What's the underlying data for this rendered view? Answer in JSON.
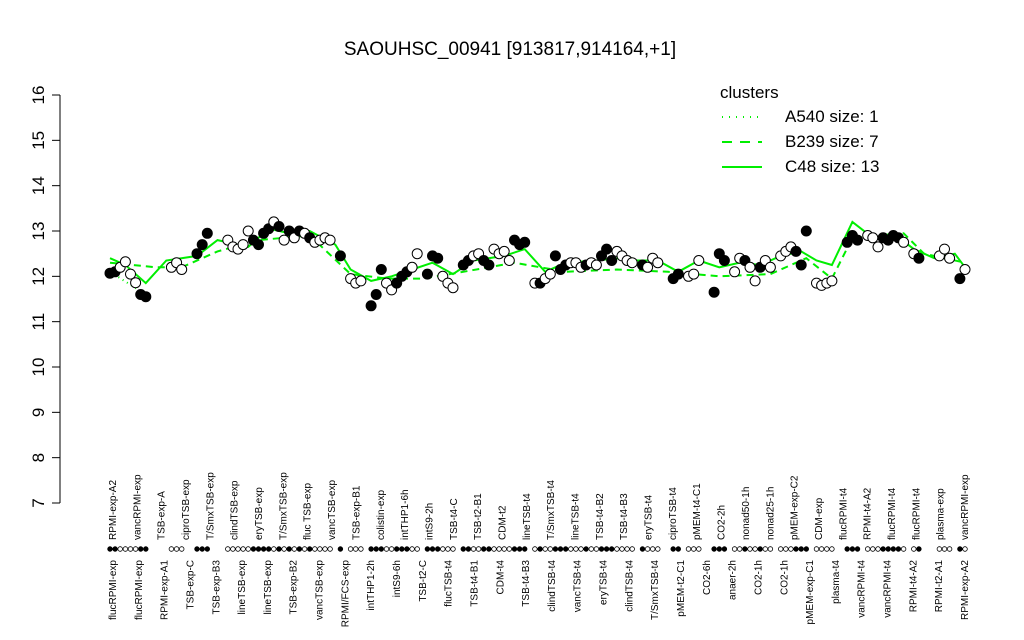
{
  "chart_data": {
    "type": "scatter",
    "title": "SAOUHSC_00941 [913817,914164,+1]",
    "xlabel": "",
    "ylabel": "",
    "ylim": [
      7,
      16
    ],
    "y_ticks": [
      "7",
      "8",
      "9",
      "10",
      "11",
      "12",
      "13",
      "14",
      "15",
      "16"
    ],
    "legend": {
      "title": "clusters",
      "position": "top-right",
      "entries": [
        {
          "label": "A540 size: 1",
          "style": "dotted"
        },
        {
          "label": "B239 size: 7",
          "style": "dashed"
        },
        {
          "label": "C48 size: 13",
          "style": "solid"
        }
      ]
    },
    "colors": {
      "cluster_line": "#00ee00",
      "points": "#000000",
      "text": "#000000"
    },
    "x_labels_top": [
      "RPMI-exp-A2",
      "vancRPMI-exp",
      "TSB-exp-A",
      "ciproTSB-exp",
      "T/SmxTSB-exp",
      "clindTSB-exp",
      "eryTSB-exp",
      "T/SmxTSB-exp",
      "fluc TSB-exp",
      "vancTSB-exp",
      "TSB-exp-B1",
      "colistin-exp",
      "intTHP1-6h",
      "intS9-2h",
      "TSB-t4-C",
      "TSB-t2-B1",
      "CDM-t2",
      "lineTSB-t4",
      "T/SmxTSB-t4",
      "lineTSB-t4",
      "TSB-t4-B2",
      "TSB-t4-B3",
      "eryTSB-t4",
      "ciproTSB-t4",
      "pMEM-t4-C1",
      "CO2-2h",
      "nonad50-1h",
      "nonad25-1h",
      "pMEM-exp-C2",
      "CDM-exp",
      "flucRPMI-t4",
      "RPMI-t4-A2",
      "flucRPMI-t4",
      "flucRPMI-t4",
      "plasma-exp",
      "vancRPMI-exp"
    ],
    "x_labels_bottom": [
      "flucRPMI-exp",
      "flucRPMI-exp",
      "RPMI-exp-A1",
      "TSB-exp-C",
      "TSB-exp-B3",
      "lineTSB-exp",
      "lineTSB-exp",
      "TSB-exp-B2",
      "vancTSB-exp",
      "RPMI/FCS-exp",
      "intTHP1-2h",
      "intS9-6h",
      "TSB-t2-C",
      "flucTSB-t4",
      "TSB-t4-B1",
      "CDM-t4",
      "TSB-t4-B3",
      "clindTSB-t4",
      "vancTSB-t4",
      "eryTSB-t4",
      "clindTSB-t4",
      "T/SmxTSB-t4",
      "pMEM-t2-C1",
      "CO2-6h",
      "anaer-2h",
      "CO2-1h",
      "CO2-1h",
      "pMEM-exp-C1",
      "plasma-t4",
      "vancRPMI-t4",
      "vancRPMI-t4",
      "RPMI-t4-A2",
      "RPMI-t2-A1",
      "RPMI-exp-A2"
    ],
    "points": [
      [
        1,
        12.07,
        1
      ],
      [
        2,
        12.1,
        1
      ],
      [
        3,
        12.2,
        0
      ],
      [
        4,
        12.32,
        0
      ],
      [
        5,
        12.05,
        0
      ],
      [
        6,
        11.86,
        0
      ],
      [
        7,
        11.6,
        1
      ],
      [
        8,
        11.55,
        1
      ],
      [
        13,
        12.2,
        0
      ],
      [
        14,
        12.3,
        0
      ],
      [
        15,
        12.15,
        0
      ],
      [
        18,
        12.5,
        1
      ],
      [
        19,
        12.7,
        1
      ],
      [
        20,
        12.95,
        1
      ],
      [
        24,
        12.8,
        0
      ],
      [
        25,
        12.65,
        0
      ],
      [
        26,
        12.6,
        0
      ],
      [
        27,
        12.7,
        0
      ],
      [
        28,
        13.0,
        0
      ],
      [
        29,
        12.8,
        1
      ],
      [
        30,
        12.7,
        1
      ],
      [
        31,
        12.95,
        1
      ],
      [
        32,
        13.05,
        1
      ],
      [
        33,
        13.2,
        0
      ],
      [
        34,
        13.1,
        1
      ],
      [
        35,
        12.8,
        0
      ],
      [
        36,
        13.0,
        1
      ],
      [
        37,
        12.85,
        0
      ],
      [
        38,
        13.0,
        1
      ],
      [
        39,
        12.95,
        0
      ],
      [
        40,
        12.85,
        1
      ],
      [
        41,
        12.75,
        0
      ],
      [
        42,
        12.8,
        0
      ],
      [
        43,
        12.85,
        0
      ],
      [
        44,
        12.8,
        0
      ],
      [
        46,
        12.45,
        1
      ],
      [
        48,
        11.95,
        0
      ],
      [
        49,
        11.85,
        0
      ],
      [
        50,
        11.9,
        0
      ],
      [
        52,
        11.35,
        1
      ],
      [
        53,
        11.6,
        1
      ],
      [
        54,
        12.15,
        1
      ],
      [
        55,
        11.85,
        0
      ],
      [
        56,
        11.7,
        0
      ],
      [
        57,
        11.85,
        1
      ],
      [
        58,
        12.0,
        1
      ],
      [
        59,
        12.1,
        1
      ],
      [
        60,
        12.2,
        0
      ],
      [
        61,
        12.5,
        0
      ],
      [
        63,
        12.05,
        1
      ],
      [
        64,
        12.45,
        1
      ],
      [
        65,
        12.4,
        1
      ],
      [
        66,
        12.0,
        0
      ],
      [
        67,
        11.85,
        0
      ],
      [
        68,
        11.75,
        0
      ],
      [
        70,
        12.25,
        1
      ],
      [
        71,
        12.35,
        1
      ],
      [
        72,
        12.45,
        0
      ],
      [
        73,
        12.5,
        0
      ],
      [
        74,
        12.35,
        1
      ],
      [
        75,
        12.25,
        1
      ],
      [
        76,
        12.6,
        0
      ],
      [
        77,
        12.5,
        0
      ],
      [
        78,
        12.55,
        0
      ],
      [
        79,
        12.35,
        0
      ],
      [
        80,
        12.8,
        1
      ],
      [
        81,
        12.7,
        1
      ],
      [
        82,
        12.75,
        1
      ],
      [
        84,
        11.85,
        0
      ],
      [
        85,
        11.85,
        1
      ],
      [
        86,
        11.95,
        0
      ],
      [
        87,
        12.05,
        0
      ],
      [
        88,
        12.45,
        1
      ],
      [
        89,
        12.15,
        1
      ],
      [
        90,
        12.25,
        1
      ],
      [
        91,
        12.3,
        0
      ],
      [
        92,
        12.3,
        0
      ],
      [
        93,
        12.2,
        0
      ],
      [
        94,
        12.25,
        1
      ],
      [
        95,
        12.3,
        0
      ],
      [
        96,
        12.25,
        0
      ],
      [
        97,
        12.45,
        1
      ],
      [
        98,
        12.6,
        1
      ],
      [
        99,
        12.35,
        1
      ],
      [
        100,
        12.55,
        0
      ],
      [
        101,
        12.45,
        0
      ],
      [
        102,
        12.35,
        0
      ],
      [
        103,
        12.3,
        0
      ],
      [
        105,
        12.25,
        1
      ],
      [
        106,
        12.2,
        0
      ],
      [
        107,
        12.4,
        0
      ],
      [
        108,
        12.3,
        0
      ],
      [
        111,
        11.95,
        1
      ],
      [
        112,
        12.05,
        1
      ],
      [
        114,
        12.0,
        0
      ],
      [
        115,
        12.05,
        0
      ],
      [
        116,
        12.35,
        0
      ],
      [
        119,
        11.65,
        1
      ],
      [
        120,
        12.5,
        1
      ],
      [
        121,
        12.35,
        1
      ],
      [
        123,
        12.1,
        0
      ],
      [
        124,
        12.4,
        0
      ],
      [
        125,
        12.35,
        1
      ],
      [
        126,
        12.2,
        0
      ],
      [
        127,
        11.9,
        0
      ],
      [
        128,
        12.2,
        1
      ],
      [
        129,
        12.35,
        0
      ],
      [
        130,
        12.2,
        0
      ],
      [
        132,
        12.45,
        0
      ],
      [
        133,
        12.55,
        0
      ],
      [
        134,
        12.65,
        0
      ],
      [
        135,
        12.55,
        1
      ],
      [
        136,
        12.25,
        1
      ],
      [
        137,
        13.0,
        1
      ],
      [
        139,
        11.85,
        0
      ],
      [
        140,
        11.8,
        0
      ],
      [
        141,
        11.85,
        0
      ],
      [
        142,
        11.9,
        0
      ],
      [
        145,
        12.75,
        1
      ],
      [
        146,
        12.9,
        1
      ],
      [
        147,
        12.8,
        1
      ],
      [
        149,
        12.9,
        0
      ],
      [
        150,
        12.85,
        0
      ],
      [
        151,
        12.65,
        0
      ],
      [
        152,
        12.85,
        1
      ],
      [
        153,
        12.8,
        1
      ],
      [
        154,
        12.9,
        1
      ],
      [
        155,
        12.85,
        1
      ],
      [
        156,
        12.75,
        0
      ],
      [
        158,
        12.5,
        0
      ],
      [
        159,
        12.4,
        1
      ],
      [
        163,
        12.45,
        0
      ],
      [
        164,
        12.6,
        0
      ],
      [
        165,
        12.4,
        0
      ],
      [
        167,
        11.95,
        1
      ],
      [
        168,
        12.15,
        0
      ]
    ],
    "cluster_lines": {
      "A540": [
        [
          1,
          12.1
        ],
        [
          8,
          11.6
        ]
      ],
      "B239": [
        [
          1,
          12.3
        ],
        [
          10,
          12.2
        ],
        [
          15,
          12.2
        ],
        [
          22,
          12.55
        ],
        [
          30,
          12.8
        ],
        [
          40,
          12.9
        ],
        [
          48,
          12.05
        ],
        [
          55,
          11.95
        ],
        [
          62,
          11.95
        ],
        [
          70,
          12.1
        ],
        [
          80,
          12.3
        ],
        [
          90,
          12.1
        ],
        [
          100,
          12.15
        ],
        [
          110,
          12.1
        ],
        [
          120,
          12.0
        ],
        [
          130,
          12.05
        ],
        [
          137,
          12.4
        ],
        [
          142,
          11.95
        ],
        [
          146,
          12.85
        ],
        [
          152,
          12.9
        ],
        [
          156,
          12.95
        ],
        [
          160,
          12.5
        ],
        [
          168,
          12.3
        ]
      ],
      "C48": [
        [
          1,
          12.4
        ],
        [
          4,
          12.25
        ],
        [
          8,
          11.85
        ],
        [
          12,
          12.35
        ],
        [
          18,
          12.45
        ],
        [
          22,
          12.8
        ],
        [
          28,
          12.65
        ],
        [
          32,
          13.05
        ],
        [
          36,
          12.95
        ],
        [
          40,
          13.0
        ],
        [
          45,
          12.7
        ],
        [
          48,
          12.15
        ],
        [
          52,
          11.9
        ],
        [
          56,
          12.0
        ],
        [
          60,
          12.15
        ],
        [
          64,
          12.3
        ],
        [
          68,
          12.05
        ],
        [
          72,
          12.35
        ],
        [
          78,
          12.45
        ],
        [
          82,
          12.6
        ],
        [
          86,
          12.1
        ],
        [
          90,
          12.3
        ],
        [
          96,
          12.35
        ],
        [
          100,
          12.4
        ],
        [
          104,
          12.35
        ],
        [
          108,
          12.35
        ],
        [
          112,
          12.1
        ],
        [
          116,
          12.35
        ],
        [
          120,
          12.2
        ],
        [
          124,
          12.3
        ],
        [
          128,
          12.25
        ],
        [
          132,
          12.45
        ],
        [
          136,
          12.55
        ],
        [
          139,
          12.35
        ],
        [
          142,
          12.25
        ],
        [
          146,
          13.2
        ],
        [
          150,
          12.85
        ],
        [
          154,
          12.95
        ],
        [
          158,
          12.6
        ],
        [
          162,
          12.4
        ],
        [
          166,
          12.5
        ],
        [
          168,
          12.2
        ]
      ]
    }
  }
}
